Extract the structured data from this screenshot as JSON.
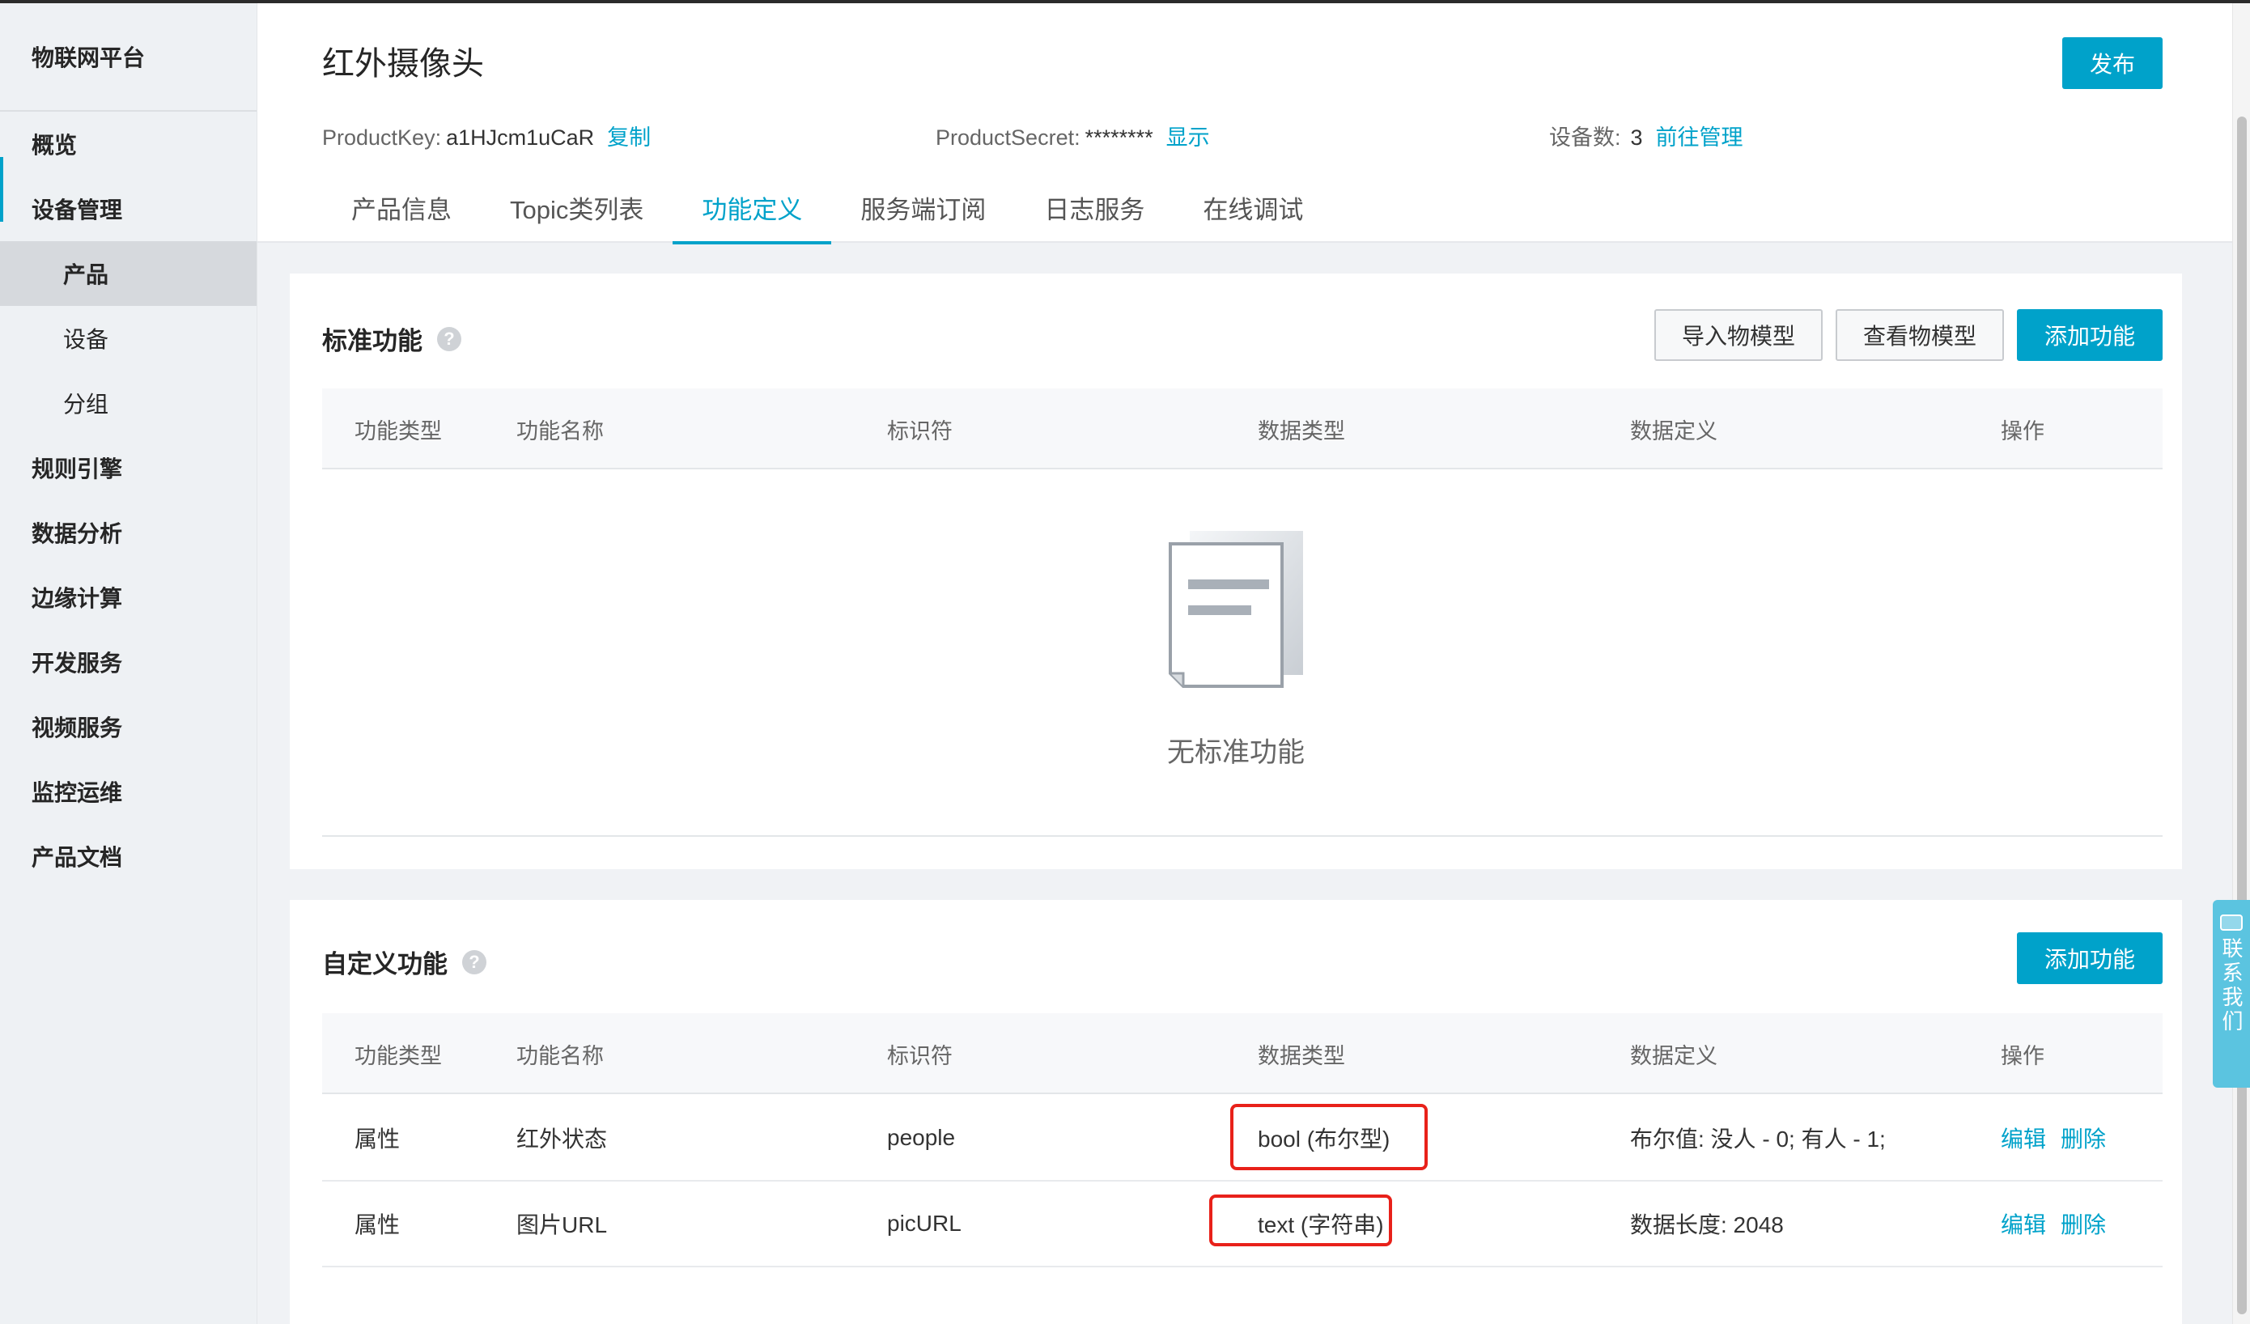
{
  "sidebar": {
    "title": "物联网平台",
    "items": [
      {
        "label": "概览"
      },
      {
        "label": "设备管理"
      },
      {
        "label": "产品"
      },
      {
        "label": "设备"
      },
      {
        "label": "分组"
      },
      {
        "label": "规则引擎"
      },
      {
        "label": "数据分析"
      },
      {
        "label": "边缘计算"
      },
      {
        "label": "开发服务"
      },
      {
        "label": "视频服务"
      },
      {
        "label": "监控运维"
      },
      {
        "label": "产品文档"
      }
    ]
  },
  "header": {
    "title": "红外摄像头",
    "publish_label": "发布",
    "product_key_label": "ProductKey:",
    "product_key_value": "a1HJcm1uCaR",
    "copy_label": "复制",
    "product_secret_label": "ProductSecret:",
    "product_secret_value": "********",
    "show_label": "显示",
    "device_count_label": "设备数:",
    "device_count_value": "3",
    "manage_label": "前往管理",
    "tabs": [
      {
        "label": "产品信息"
      },
      {
        "label": "Topic类列表"
      },
      {
        "label": "功能定义"
      },
      {
        "label": "服务端订阅"
      },
      {
        "label": "日志服务"
      },
      {
        "label": "在线调试"
      }
    ]
  },
  "standard": {
    "title": "标准功能",
    "import_label": "导入物模型",
    "view_label": "查看物模型",
    "add_label": "添加功能",
    "empty_text": "无标准功能"
  },
  "columns": [
    "功能类型",
    "功能名称",
    "标识符",
    "数据类型",
    "数据定义",
    "操作"
  ],
  "custom": {
    "title": "自定义功能",
    "add_label": "添加功能",
    "rows": [
      {
        "type": "属性",
        "name": "红外状态",
        "identifier": "people",
        "data_type": "bool (布尔型)",
        "definition": "布尔值: 没人 - 0; 有人 - 1;",
        "edit": "编辑",
        "delete": "删除"
      },
      {
        "type": "属性",
        "name": "图片URL",
        "identifier": "picURL",
        "data_type": "text (字符串)",
        "definition": "数据长度: 2048",
        "edit": "编辑",
        "delete": "删除"
      }
    ]
  },
  "contact": {
    "label": "联系我们"
  },
  "colors": {
    "accent": "#00a2ca",
    "highlight": "#e8211a"
  }
}
